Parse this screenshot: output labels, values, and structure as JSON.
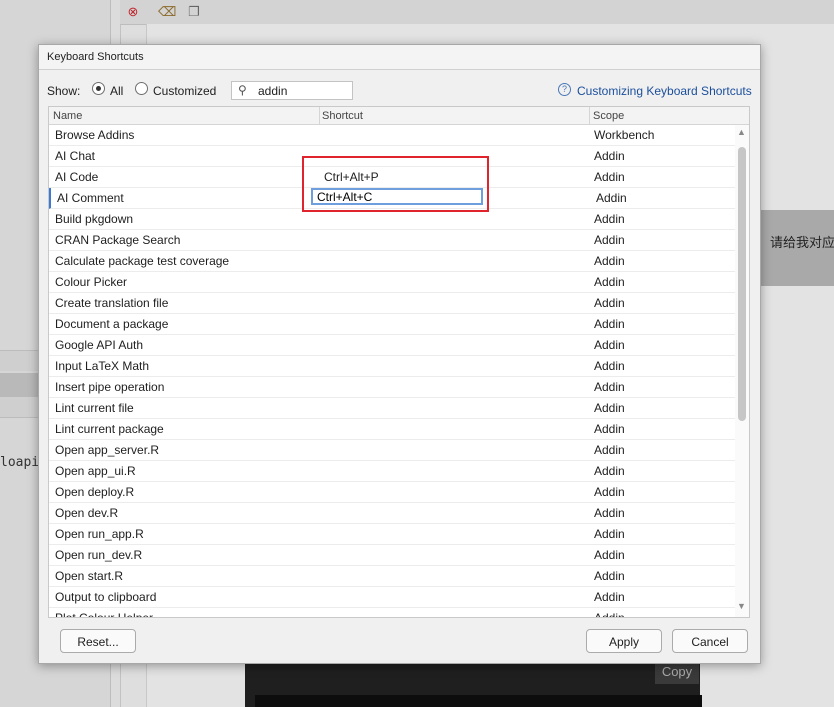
{
  "background": {
    "code_snippet": "loapi:",
    "chinese_text": "请给我对应",
    "copy_label": "Copy"
  },
  "dialog": {
    "title": "Keyboard Shortcuts",
    "show_label": "Show:",
    "filter_all": "All",
    "filter_customized": "Customized",
    "filter_selected": "All",
    "search_value": "addin",
    "help_link": "Customizing Keyboard Shortcuts",
    "columns": {
      "name": "Name",
      "shortcut": "Shortcut",
      "scope": "Scope"
    },
    "rows": [
      {
        "name": "Browse Addins",
        "shortcut": "",
        "scope": "Workbench"
      },
      {
        "name": "AI Chat",
        "shortcut": "",
        "scope": "Addin"
      },
      {
        "name": "AI Code",
        "shortcut": "Ctrl+Alt+P",
        "scope": "Addin"
      },
      {
        "name": "AI Comment",
        "shortcut": "Ctrl+Alt+C",
        "scope": "Addin",
        "editing": true
      },
      {
        "name": "Build pkgdown",
        "shortcut": "",
        "scope": "Addin"
      },
      {
        "name": "CRAN Package Search",
        "shortcut": "",
        "scope": "Addin"
      },
      {
        "name": "Calculate package test coverage",
        "shortcut": "",
        "scope": "Addin"
      },
      {
        "name": "Colour Picker",
        "shortcut": "",
        "scope": "Addin"
      },
      {
        "name": "Create translation file",
        "shortcut": "",
        "scope": "Addin"
      },
      {
        "name": "Document a package",
        "shortcut": "",
        "scope": "Addin"
      },
      {
        "name": "Google API Auth",
        "shortcut": "",
        "scope": "Addin"
      },
      {
        "name": "Input LaTeX Math",
        "shortcut": "",
        "scope": "Addin"
      },
      {
        "name": "Insert pipe operation",
        "shortcut": "",
        "scope": "Addin"
      },
      {
        "name": "Lint current file",
        "shortcut": "",
        "scope": "Addin"
      },
      {
        "name": "Lint current package",
        "shortcut": "",
        "scope": "Addin"
      },
      {
        "name": "Open app_server.R",
        "shortcut": "",
        "scope": "Addin"
      },
      {
        "name": "Open app_ui.R",
        "shortcut": "",
        "scope": "Addin"
      },
      {
        "name": "Open deploy.R",
        "shortcut": "",
        "scope": "Addin"
      },
      {
        "name": "Open dev.R",
        "shortcut": "",
        "scope": "Addin"
      },
      {
        "name": "Open run_app.R",
        "shortcut": "",
        "scope": "Addin"
      },
      {
        "name": "Open run_dev.R",
        "shortcut": "",
        "scope": "Addin"
      },
      {
        "name": "Open start.R",
        "shortcut": "",
        "scope": "Addin"
      },
      {
        "name": "Output to clipboard",
        "shortcut": "",
        "scope": "Addin"
      },
      {
        "name": "Plot Colour Helper",
        "shortcut": "",
        "scope": "Addin"
      }
    ],
    "buttons": {
      "reset": "Reset...",
      "apply": "Apply",
      "cancel": "Cancel"
    },
    "highlight_color": "#e0242e"
  }
}
